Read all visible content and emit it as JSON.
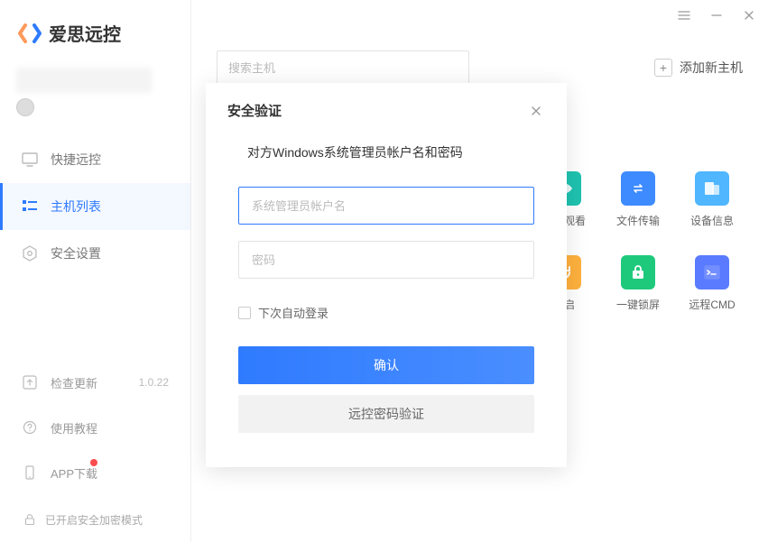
{
  "brand": {
    "text": "爱思远控"
  },
  "sidebar": {
    "items": [
      {
        "label": "快捷远控"
      },
      {
        "label": "主机列表"
      },
      {
        "label": "安全设置"
      }
    ],
    "bottom": {
      "update": {
        "label": "检查更新",
        "version": "1.0.22"
      },
      "tutorial": {
        "label": "使用教程"
      },
      "app": {
        "label": "APP下载"
      }
    },
    "secure_mode": "已开启安全加密模式"
  },
  "window": {
    "menu": "≡",
    "min": "—",
    "close": "✕"
  },
  "main": {
    "search_placeholder": "搜索主机",
    "add_host": "添加新主机",
    "actions": [
      {
        "label": "远程观看"
      },
      {
        "label": "文件传输"
      },
      {
        "label": "设备信息"
      },
      {
        "label": "重启"
      },
      {
        "label": "一键锁屏"
      },
      {
        "label": "远程CMD"
      }
    ]
  },
  "modal": {
    "title": "安全验证",
    "subtitle": "对方Windows系统管理员帐户名和密码",
    "username_placeholder": "系统管理员帐户名",
    "password_placeholder": "密码",
    "auto_login": "下次自动登录",
    "confirm": "确认",
    "alt_verify": "远控密码验证"
  }
}
